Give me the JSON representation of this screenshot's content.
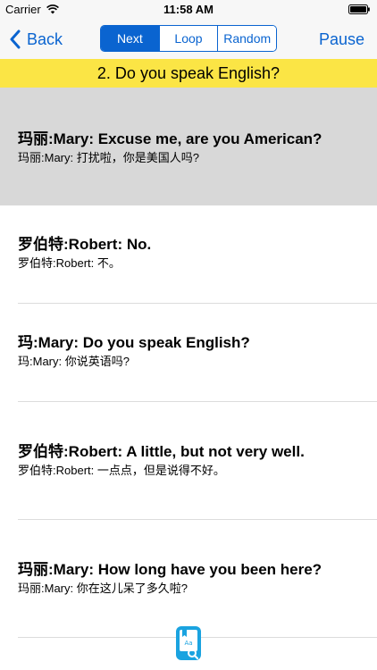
{
  "status_bar": {
    "carrier": "Carrier",
    "time": "11:58 AM"
  },
  "nav": {
    "back_label": "Back",
    "segments": [
      "Next",
      "Loop",
      "Random"
    ],
    "active_segment": "Next",
    "pause_label": "Pause"
  },
  "lesson_title": "2. Do you speak English?",
  "dialogs": [
    {
      "english": "玛丽:Mary: Excuse me, are you American?",
      "chinese": "玛丽:Mary: 打扰啦，你是美国人吗?",
      "selected": true
    },
    {
      "english": "罗伯特:Robert: No.",
      "chinese": "罗伯特:Robert: 不。",
      "selected": false
    },
    {
      "english": "玛:Mary: Do you speak English?",
      "chinese": "玛:Mary: 你说英语吗?",
      "selected": false
    },
    {
      "english": "罗伯特:Robert: A little, but not very well.",
      "chinese": "罗伯特:Robert: 一点点，但是说得不好。",
      "selected": false
    },
    {
      "english": "玛丽:Mary: How long have you been here?",
      "chinese": "玛丽:Mary: 你在这儿呆了多久啦?",
      "selected": false
    }
  ],
  "colors": {
    "accent": "#0a64d0",
    "banner": "#fbe545",
    "selected_row": "#d8d8d8"
  },
  "icons": {
    "back": "chevron-left-icon",
    "wifi": "wifi-icon",
    "battery": "battery-icon",
    "dictionary": "dictionary-search-icon"
  }
}
